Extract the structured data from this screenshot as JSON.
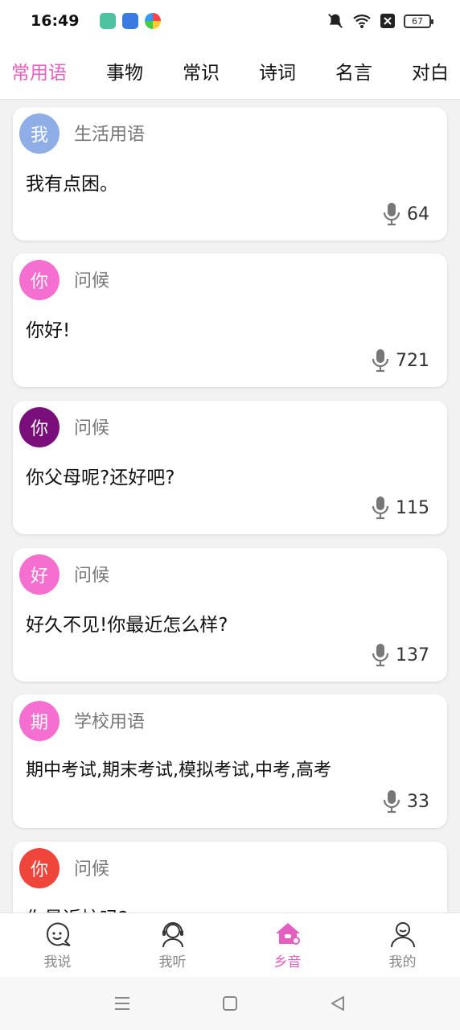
{
  "status_bar": {
    "time": "16:49",
    "battery": "67"
  },
  "tabs": [
    {
      "label": "常用语",
      "active": true
    },
    {
      "label": "事物"
    },
    {
      "label": "常识"
    },
    {
      "label": "诗词"
    },
    {
      "label": "名言"
    },
    {
      "label": "对白"
    }
  ],
  "cards": [
    {
      "avatar": "我",
      "avatar_color": "#8faee8",
      "category": "生活用语",
      "phrase": "我有点困。",
      "count": "64"
    },
    {
      "avatar": "你",
      "avatar_color": "#f56fd0",
      "category": "问候",
      "phrase": "你好!",
      "count": "721"
    },
    {
      "avatar": "你",
      "avatar_color": "#7a0f7c",
      "category": "问候",
      "phrase": "你父母呢?还好吧?",
      "count": "115"
    },
    {
      "avatar": "好",
      "avatar_color": "#f56fd0",
      "category": "问候",
      "phrase": "好久不见!你最近怎么样?",
      "count": "137"
    },
    {
      "avatar": "期",
      "avatar_color": "#f56fd0",
      "category": "学校用语",
      "phrase": "期中考试,期末考试,模拟考试,中考,高考",
      "count": "33"
    },
    {
      "avatar": "你",
      "avatar_color": "#f0453b",
      "category": "问候",
      "phrase": "你最近忙吗?",
      "count": ""
    }
  ],
  "bottom_nav": [
    {
      "label": "我说",
      "icon": "speech-face-icon"
    },
    {
      "label": "我听",
      "icon": "headphones-person-icon"
    },
    {
      "label": "乡音",
      "icon": "home-mic-icon",
      "active": true
    },
    {
      "label": "我的",
      "icon": "person-icon"
    }
  ],
  "colors": {
    "accent": "#e55fc0"
  }
}
